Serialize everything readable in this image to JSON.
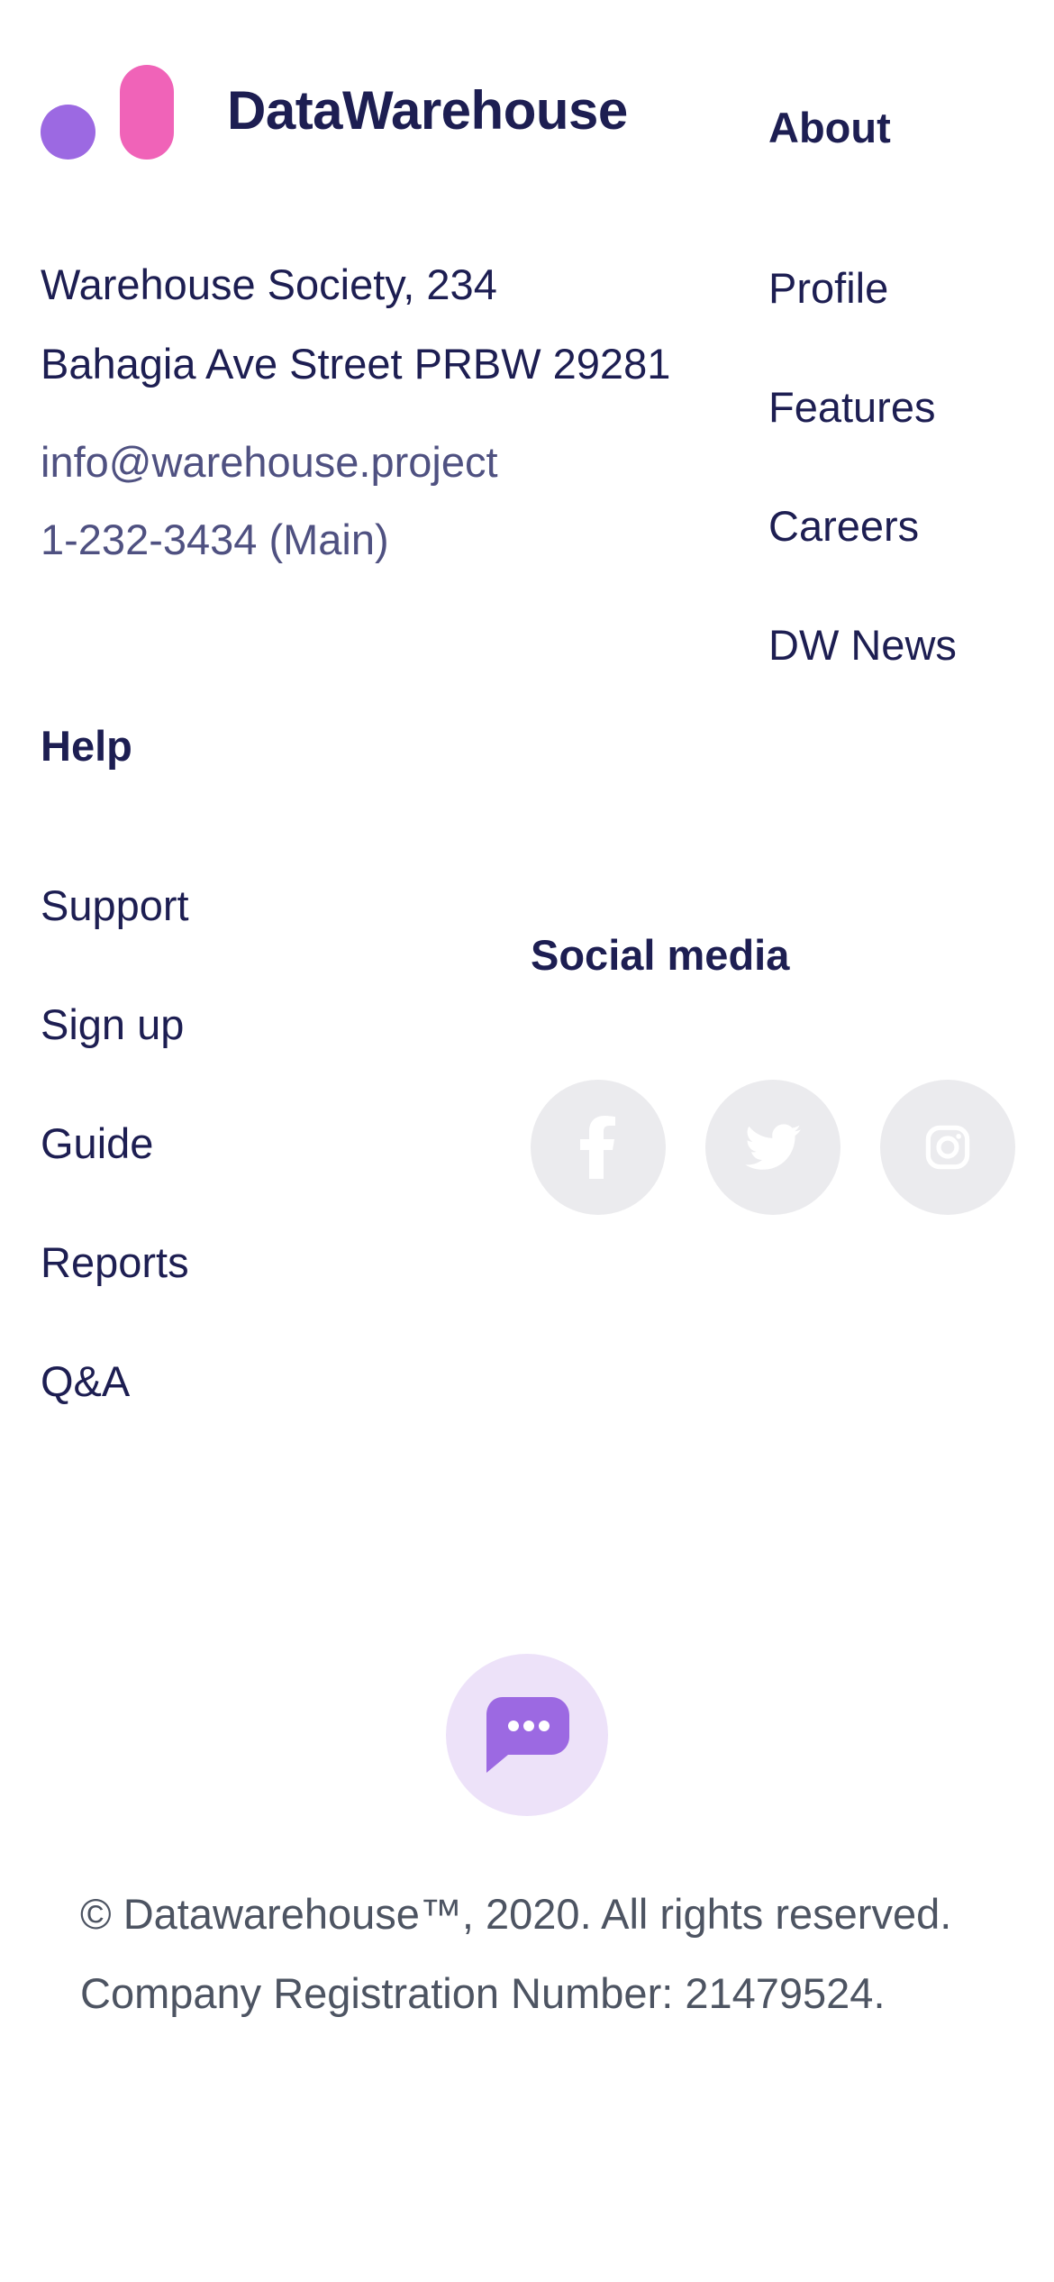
{
  "brand": {
    "name": "DataWarehouse",
    "colors": {
      "dot": "#9c69e2",
      "pill": "#f063b8",
      "text": "#1d1e52"
    }
  },
  "address": {
    "line1": "Warehouse Society, 234",
    "line2": "Bahagia Ave Street PRBW 29281"
  },
  "contact": {
    "email": "info@warehouse.project",
    "phone": "1-232-3434 (Main)"
  },
  "about": {
    "title": "About",
    "links": [
      "Profile",
      "Features",
      "Careers",
      "DW News"
    ]
  },
  "help": {
    "title": "Help",
    "links": [
      "Support",
      "Sign up",
      "Guide",
      "Reports",
      "Q&A"
    ]
  },
  "social": {
    "title": "Social media",
    "icons": [
      "facebook-icon",
      "twitter-icon",
      "instagram-icon"
    ]
  },
  "chat": {
    "icon": "chat-bubble-icon",
    "accent": "#9c69e2"
  },
  "footer": {
    "copyright": "© Datawarehouse™, 2020. All rights reserved.",
    "registration": "Company Registration Number: 21479524."
  }
}
